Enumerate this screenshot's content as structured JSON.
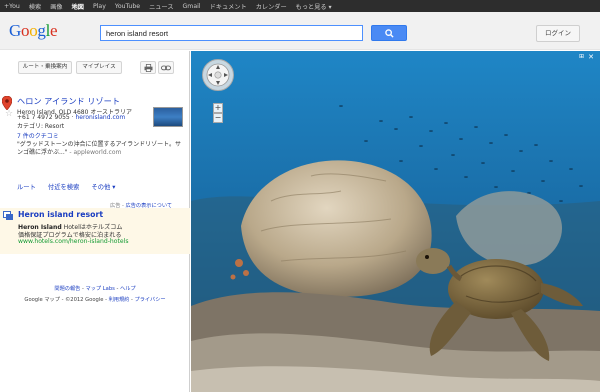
{
  "gbar": {
    "items": [
      "+You",
      "検索",
      "画像",
      "地図",
      "Play",
      "YouTube",
      "ニュース",
      "Gmail",
      "ドキュメント",
      "カレンダー",
      "もっと見る ▾"
    ],
    "active_index": 3
  },
  "header": {
    "logo": [
      "G",
      "o",
      "o",
      "g",
      "l",
      "e"
    ],
    "search_value": "heron island resort",
    "login_label": "ログイン"
  },
  "toolbar": {
    "route_label": "ルート・乗換案内",
    "myplaces_label": "マイプレイス"
  },
  "result": {
    "title": "ヘロン アイランド リゾート",
    "address": "Heron Island, QLD 4680 オーストラリア",
    "phone": "+61 7 4972 9055",
    "phone_sep": " · ",
    "website": "heronisland.com",
    "category": "カテゴリ: Resort",
    "reviews": "7 件のクチコミ",
    "snippet": "\"グラッドストーンの沖合に位置するアイランドリゾート。サンゴ礁に浮かぶ...\"",
    "snippet_source": " - appleworld.com",
    "actions": [
      "ルート",
      "付近を検索",
      "その他 ▾"
    ]
  },
  "ad": {
    "label_prefix": "広告 - ",
    "label_link": "広告の表示について",
    "title": "Heron island resort",
    "line1_bold": "Heron Island",
    "line1_rest": " Hotelはホテルズコム",
    "line2": "価格保証プログラムで格安に泊まれる",
    "url": "www.hotels.com/heron-island-hotels"
  },
  "footer": {
    "row1_links": [
      "問題の報告",
      "マップ Labs",
      "ヘルプ"
    ],
    "row1_sep": " - ",
    "row2_prefix": "Google マップ - ©2012 Google - ",
    "row2_links": [
      "利用規約",
      "プライバシー"
    ],
    "row2_sep": " - "
  },
  "map": {
    "close": "✕",
    "toggle": "⊞"
  },
  "colors": {
    "water": "#1b79b8",
    "coral": "#c9b9a0",
    "turtle": "#7d6a45",
    "accent_link": "#1a3dc1",
    "ad_bg": "#fef8e7"
  }
}
